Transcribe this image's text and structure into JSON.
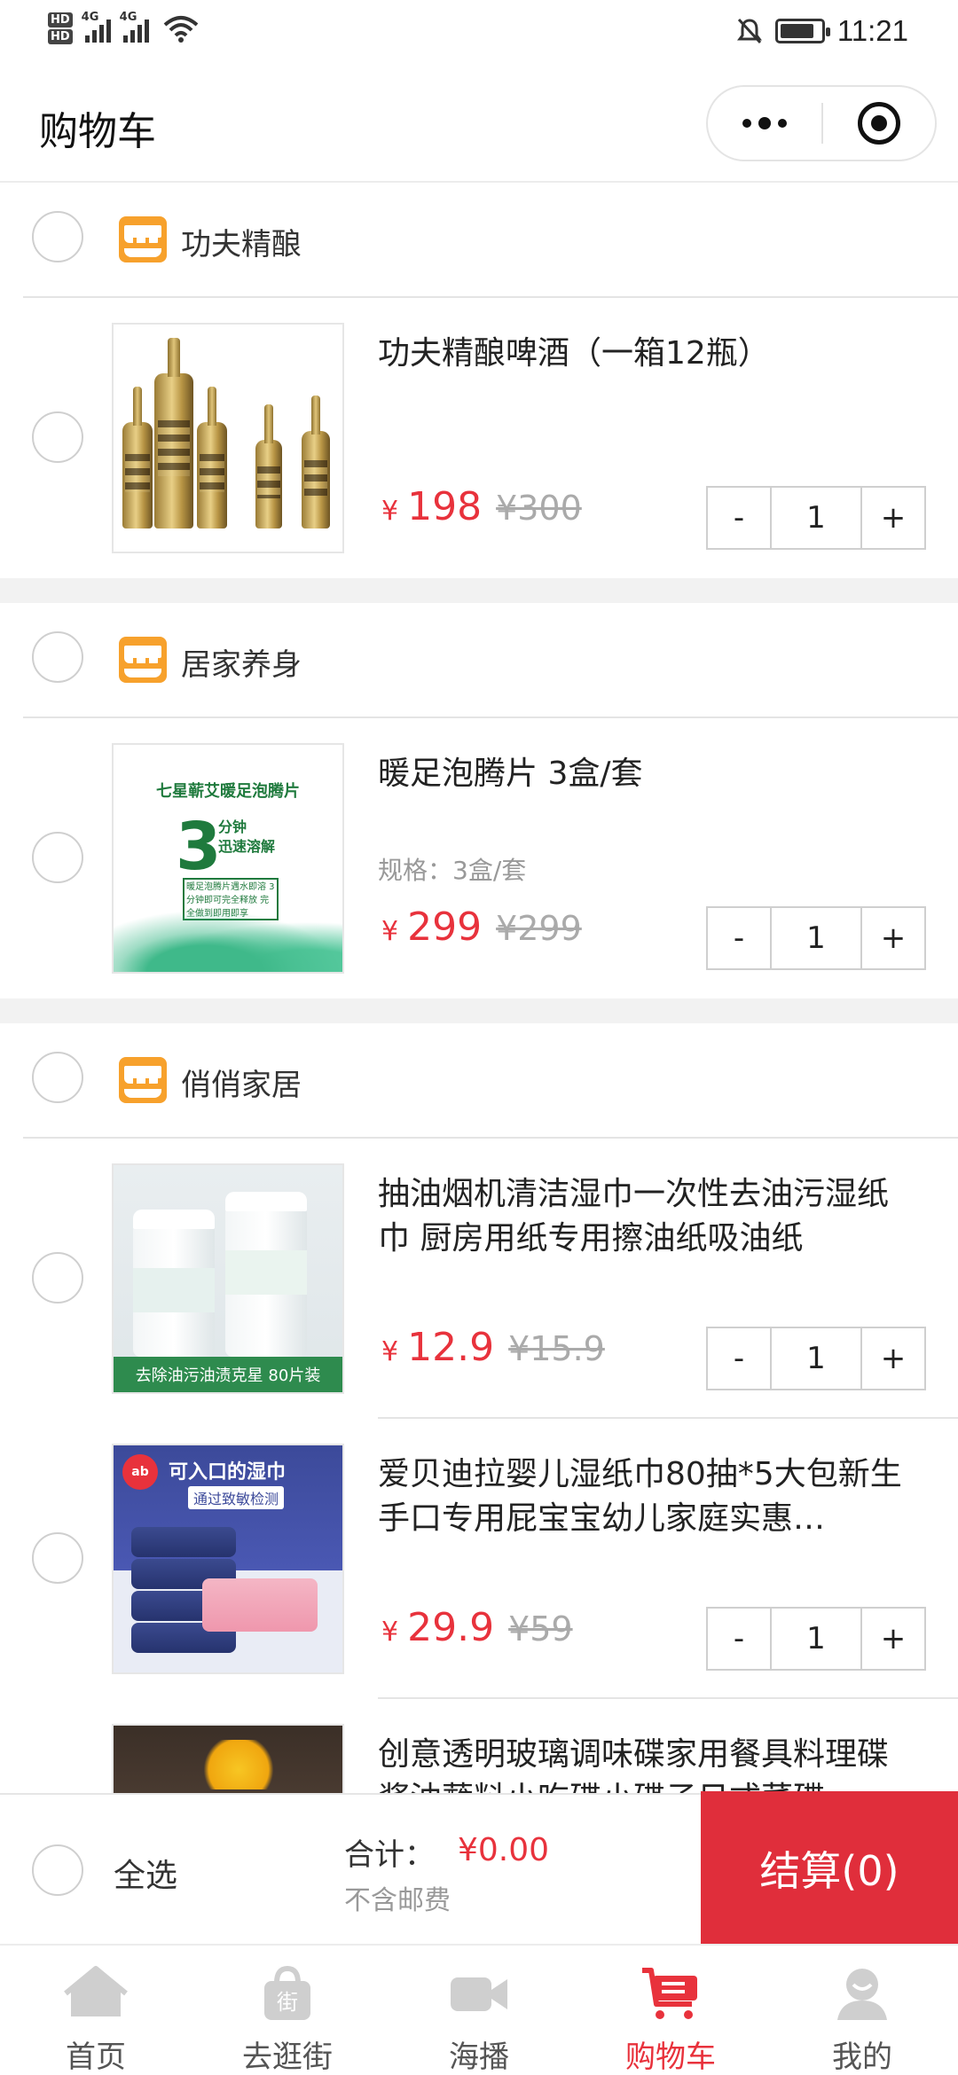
{
  "status_bar": {
    "time": "11:21",
    "hd1": "HD",
    "hd2": "HD",
    "net1": "4G",
    "net2": "4G"
  },
  "header": {
    "title": "购物车"
  },
  "stores": [
    {
      "name": "功夫精酿",
      "items": [
        {
          "title": "功夫精酿啤酒（一箱12瓶）",
          "spec": "",
          "price_symbol": "¥",
          "price": "198",
          "original_price": "¥300",
          "minus": "-",
          "quantity": "1",
          "plus": "+"
        }
      ]
    },
    {
      "name": "居家养身",
      "items": [
        {
          "title": "暖足泡腾片 3盒/套",
          "spec": "规格：3盒/套",
          "price_symbol": "¥",
          "price": "299",
          "original_price": "¥299",
          "minus": "-",
          "quantity": "1",
          "plus": "+",
          "image_text": {
            "line1": "七星蕲艾暖足泡腾片",
            "big": "3",
            "line2": "分钟",
            "line3": "迅速溶解",
            "box": "暖足泡腾片遇水即溶 3分钟即可完全释放 完全做到即用即享"
          }
        }
      ]
    },
    {
      "name": "俏俏家居",
      "items": [
        {
          "title": "抽油烟机清洁湿巾一次性去油污湿纸巾 厨房用纸专用擦油纸吸油纸",
          "spec": "",
          "price_symbol": "¥",
          "price": "12.9",
          "original_price": "¥15.9",
          "minus": "-",
          "quantity": "1",
          "plus": "+",
          "image_text": "去除油污油渍克星 80片装"
        },
        {
          "title": "爱贝迪拉婴儿湿纸巾80抽*5大包新生手口专用屁宝宝幼儿家庭实惠…",
          "spec": "",
          "price_symbol": "¥",
          "price": "29.9",
          "original_price": "¥59",
          "minus": "-",
          "quantity": "1",
          "plus": "+",
          "image_text": {
            "logo": "ab",
            "headline": "可入口的湿巾",
            "sub": "通过致敏检测"
          }
        },
        {
          "title": "创意透明玻璃调味碟家用餐具料理碟酱油蘸料小吃碟小碟子日式菜碟",
          "spec": "",
          "price_symbol": "",
          "price": "",
          "original_price": "",
          "minus": "",
          "quantity": "",
          "plus": ""
        }
      ]
    }
  ],
  "checkout": {
    "select_all": "全选",
    "total_label": "合计：",
    "total_value": "¥0.00",
    "shipping_note": "不含邮费",
    "button": "结算(0)"
  },
  "tabbar": [
    {
      "label": "首页",
      "icon": "home-icon"
    },
    {
      "label": "去逛街",
      "icon": "shopping-bag-icon"
    },
    {
      "label": "海播",
      "icon": "video-camera-icon"
    },
    {
      "label": "购物车",
      "icon": "cart-icon",
      "active": true
    },
    {
      "label": "我的",
      "icon": "user-icon"
    }
  ],
  "colors": {
    "accent": "#e8323c",
    "checkout_button": "#e02e3b",
    "store_icon": "#f7a12c",
    "tab_icon": "#cfcfcf"
  }
}
